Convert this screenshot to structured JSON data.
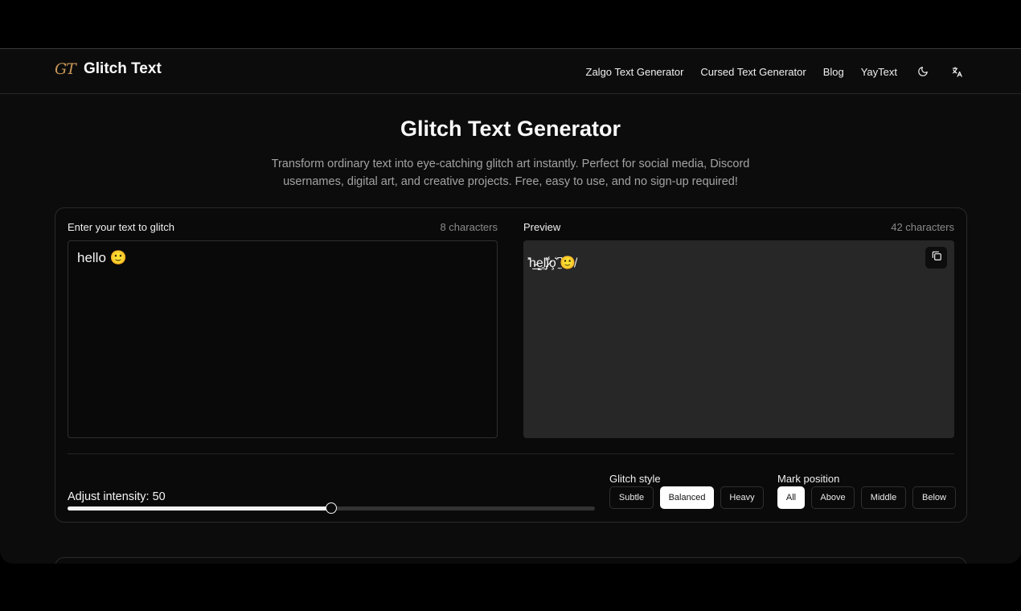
{
  "brand": {
    "logo_text": "GT",
    "name": "Glitch Text"
  },
  "nav": {
    "links": [
      "Zalgo Text Generator",
      "Cursed Text Generator",
      "Blog",
      "YayText"
    ],
    "icons": [
      "moon-icon",
      "translate-icon"
    ]
  },
  "hero": {
    "title": "Glitch Text Generator",
    "subtitle": "Transform ordinary text into eye-catching glitch art instantly. Perfect for social media, Discord usernames, digital art, and creative projects. Free, easy to use, and no sign-up required!"
  },
  "input": {
    "label": "Enter your text to glitch",
    "count": "8 characters",
    "value": "hello 🙂"
  },
  "preview": {
    "label": "Preview",
    "count": "42 characters",
    "value": "̽h̵̲e̳̥l̡̓l̷̾o̧͛ ̼͆🙂̸",
    "copy_icon": "copy-icon"
  },
  "intensity": {
    "label": "Adjust intensity: 50",
    "value": 50,
    "max": 100
  },
  "glitch_style": {
    "label": "Glitch style",
    "options": [
      "Subtle",
      "Balanced",
      "Heavy"
    ],
    "selected": "Balanced"
  },
  "mark_position": {
    "label": "Mark position",
    "options": [
      "All",
      "Above",
      "Middle",
      "Below"
    ],
    "selected": "All"
  },
  "colors": {
    "accent": "#ffffff",
    "logo": "#c9975a",
    "background": "#0c0c0c"
  }
}
